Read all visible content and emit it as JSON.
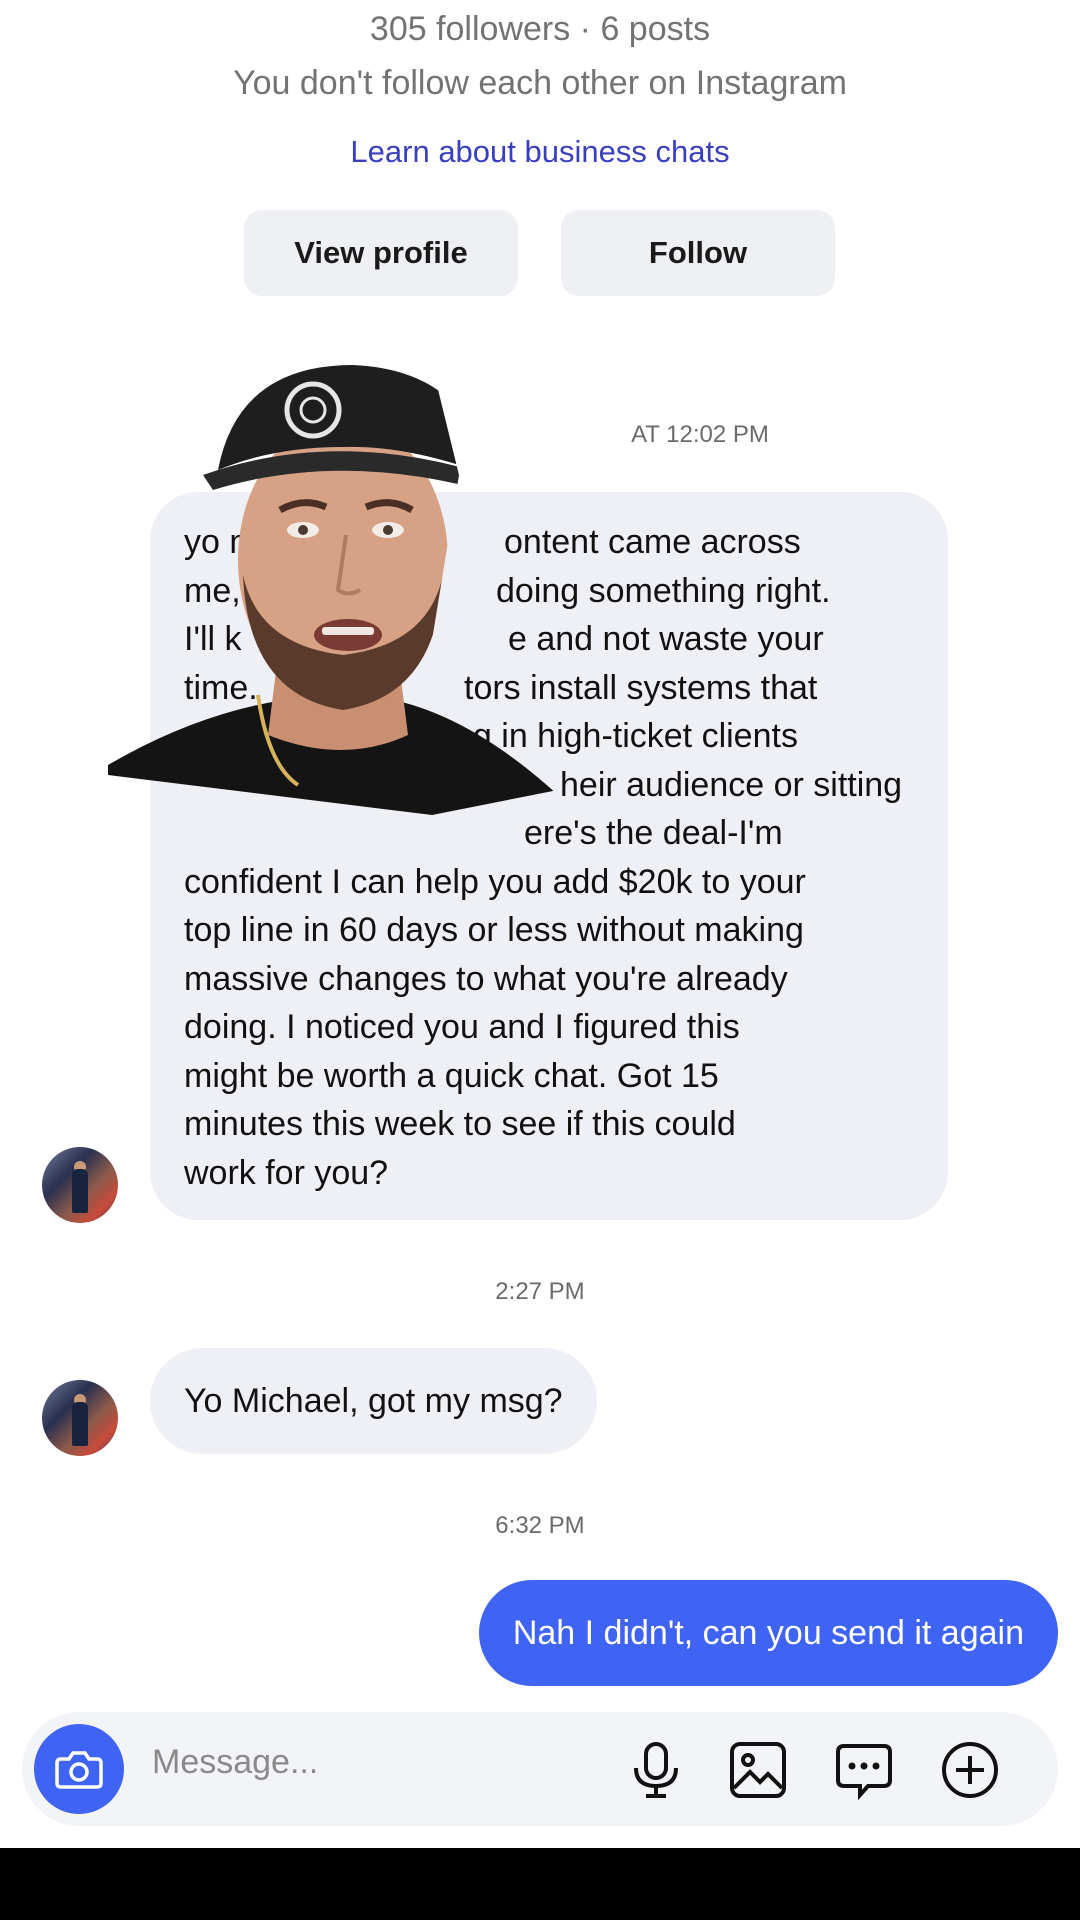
{
  "header": {
    "stats": "305 followers · 6 posts",
    "relationship": "You don't follow each other on Instagram",
    "learn_link": "Learn about business chats"
  },
  "actions": {
    "view_profile": "View profile",
    "follow": "Follow"
  },
  "messages": [
    {
      "timestamp": "AT 12:02 PM",
      "sender": "them",
      "lines": [
        "yo m",
        "me,",
        "I'll k",
        "time.",
        "",
        "",
        "",
        "confident I can help you add $20k to your",
        "top line in 60 days or less without making",
        "massive changes to what you're already",
        "doing. I noticed you and I figured this",
        "might be worth a quick chat. Got 15",
        "minutes this week to see if this could",
        "work for you?"
      ],
      "fragments_right": [
        "ontent came across",
        "doing something right.",
        "e and not waste your",
        "tors install systems that",
        "ng in high-ticket clients",
        "heir audience or sitting",
        "ere's the deal-I'm"
      ]
    },
    {
      "timestamp": "2:27 PM",
      "sender": "them",
      "text": "Yo Michael, got my msg?"
    },
    {
      "timestamp": "6:32 PM",
      "sender": "me",
      "text": "Nah I didn't, can you send it again"
    }
  ],
  "composer": {
    "placeholder": "Message...",
    "icons": [
      "camera-icon",
      "microphone-icon",
      "gallery-icon",
      "chat-bubble-icon",
      "plus-circle-icon"
    ]
  },
  "colors": {
    "accent": "#3f63f3",
    "link": "#3a3fc0",
    "bubble_received": "#eff0f5",
    "muted_text": "#737373"
  }
}
